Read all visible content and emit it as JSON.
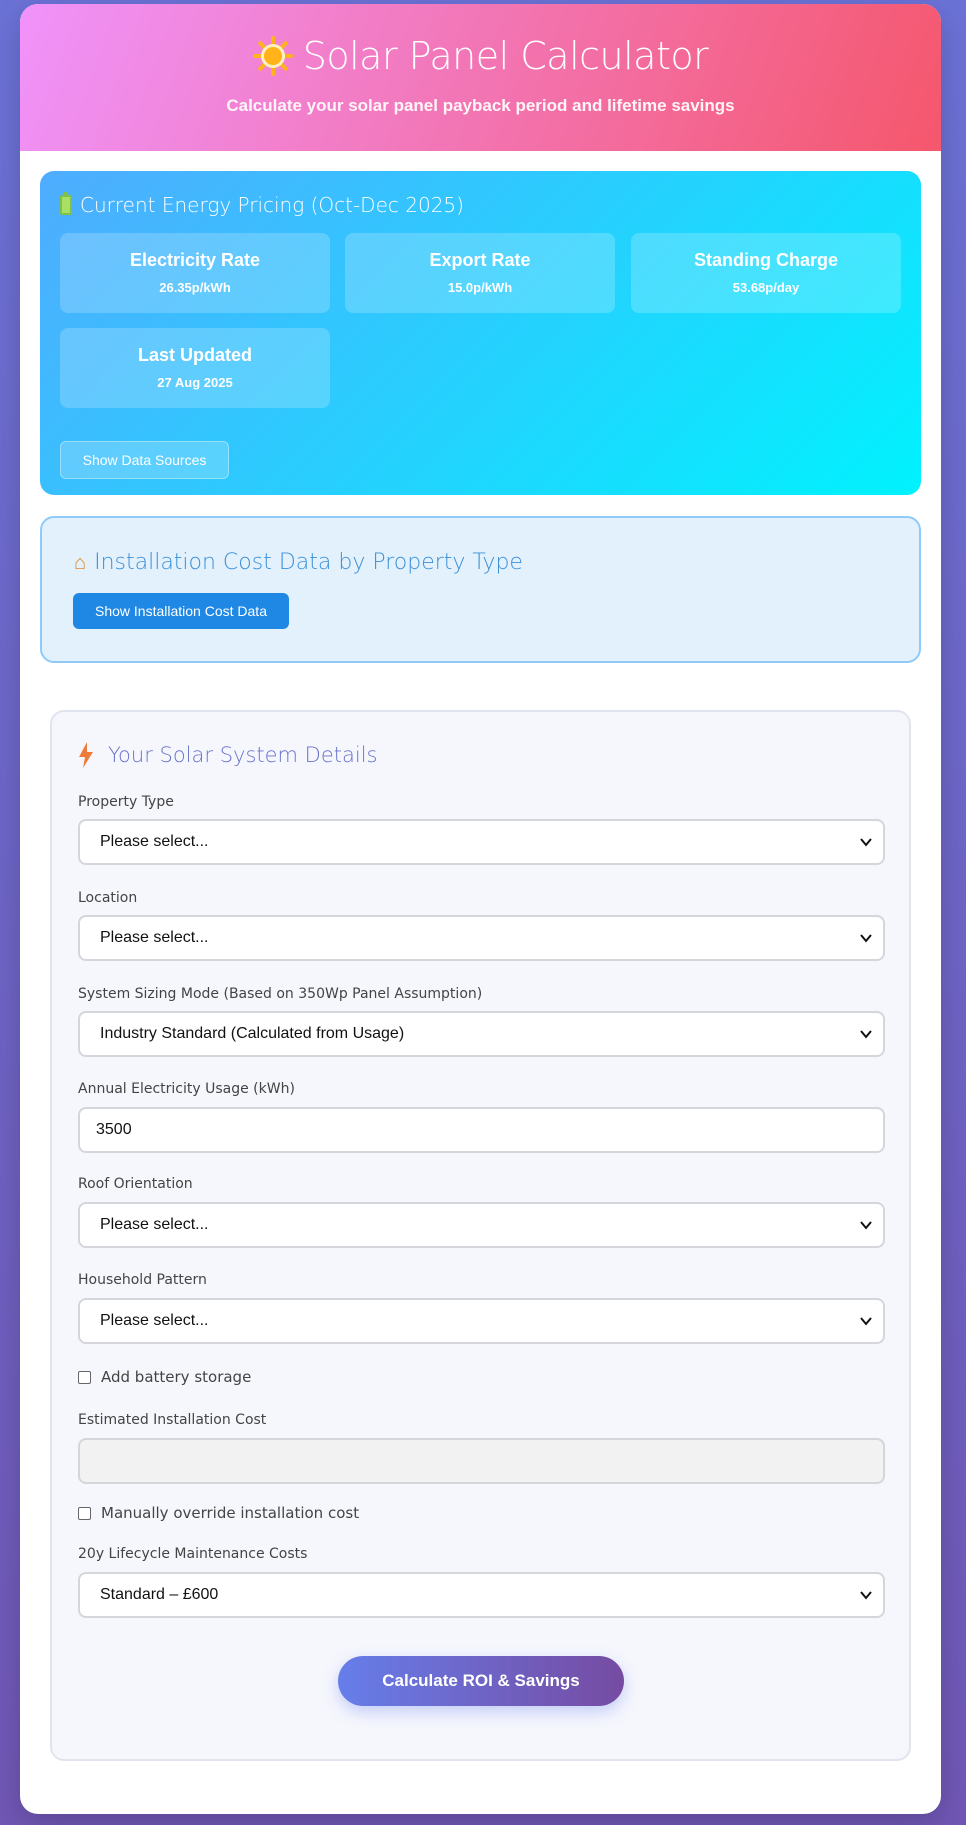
{
  "header": {
    "title": "Solar Panel Calculator",
    "subtitle": "Calculate your solar panel payback period and lifetime savings",
    "icon": "sun-icon"
  },
  "pricing": {
    "title": "Current Energy Pricing (Oct-Dec 2025)",
    "icon": "battery-icon",
    "cards": [
      {
        "label": "Electricity Rate",
        "value": "26.35p/kWh"
      },
      {
        "label": "Export Rate",
        "value": "15.0p/kWh"
      },
      {
        "label": "Standing Charge",
        "value": "53.68p/day"
      },
      {
        "label": "Last Updated",
        "value": "27 Aug 2025"
      }
    ],
    "sources_button": "Show Data Sources"
  },
  "installation": {
    "title": "Installation Cost Data by Property Type",
    "icon": "house-icon",
    "button": "Show Installation Cost Data"
  },
  "form": {
    "title": "Your Solar System Details",
    "icon": "lightning-icon",
    "property_type": {
      "label": "Property Type",
      "value": "Please select..."
    },
    "location": {
      "label": "Location",
      "value": "Please select..."
    },
    "sizing_mode": {
      "label": "System Sizing Mode (Based on 350Wp Panel Assumption)",
      "value": "Industry Standard (Calculated from Usage)"
    },
    "annual_usage": {
      "label": "Annual Electricity Usage (kWh)",
      "value": "3500"
    },
    "roof_orientation": {
      "label": "Roof Orientation",
      "value": "Please select..."
    },
    "household_pattern": {
      "label": "Household Pattern",
      "value": "Please select..."
    },
    "battery": {
      "label": "Add battery storage",
      "checked": false
    },
    "est_cost": {
      "label": "Estimated Installation Cost",
      "value": ""
    },
    "override": {
      "label": "Manually override installation cost",
      "checked": false
    },
    "maintenance": {
      "label": "20y Lifecycle Maintenance Costs",
      "value": "Standard – £600"
    },
    "submit": "Calculate ROI & Savings"
  }
}
